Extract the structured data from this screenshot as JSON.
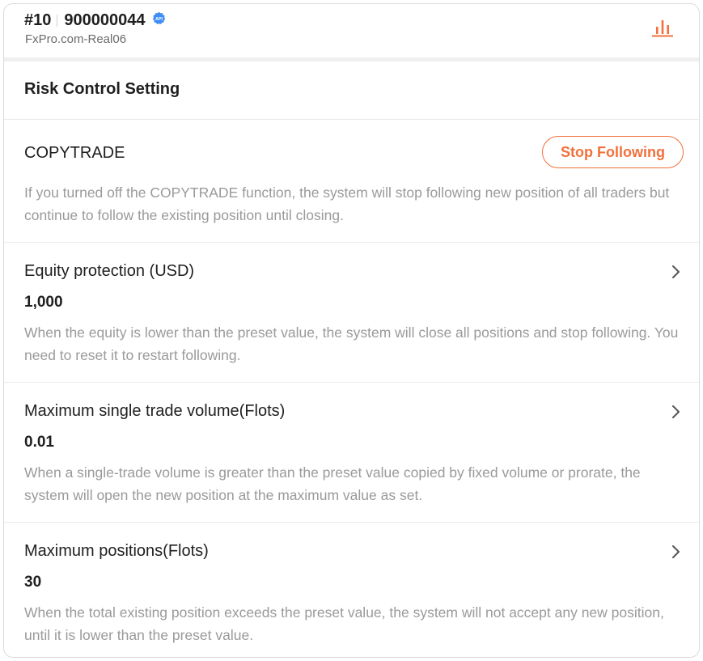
{
  "header": {
    "account_number": "#10",
    "account_id": "900000044",
    "api_badge": "API",
    "server": "FxPro.com-Real06",
    "chart_icon": "bar-chart-icon"
  },
  "section_title": "Risk Control Setting",
  "copytrade": {
    "title": "COPYTRADE",
    "button_label": "Stop Following",
    "description": "If you turned off the COPYTRADE function, the system will stop following new position of all traders but continue to follow the existing position until closing."
  },
  "settings": [
    {
      "title": "Equity protection (USD)",
      "value": "1,000",
      "description": "When the equity is lower than the preset value, the system will close all positions and stop following. You need to reset it to restart following."
    },
    {
      "title": "Maximum single trade volume(Flots)",
      "value": "0.01",
      "description": "When a single-trade volume is greater than the preset value copied by fixed volume or prorate, the system will open the new position at the maximum value as set."
    },
    {
      "title": "Maximum positions(Flots)",
      "value": "30",
      "description": "When the total existing position exceeds the preset value, the system will not accept any new position, until it is lower than the preset value."
    }
  ],
  "colors": {
    "accent": "#f2703b",
    "badge_blue": "#3f8ef5",
    "text_primary": "#1f1f1f",
    "text_secondary": "#9a9a9a"
  }
}
